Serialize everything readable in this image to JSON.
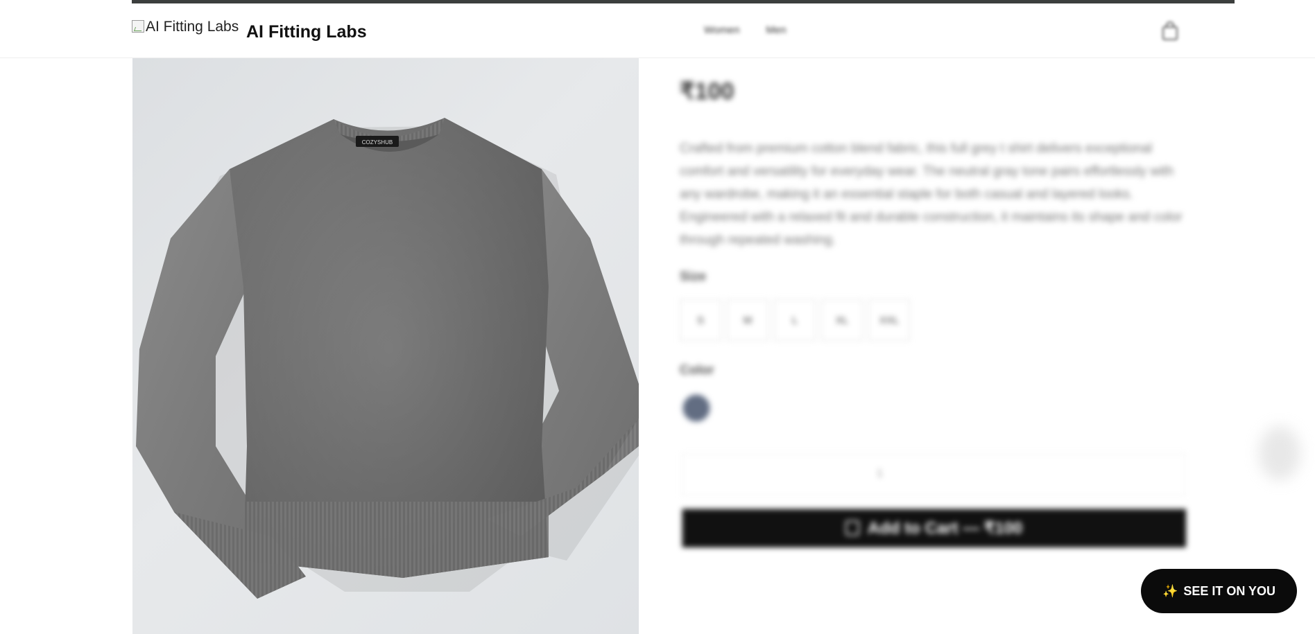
{
  "header": {
    "logo_alt": "AI Fitting Labs",
    "brand": "AI Fitting Labs",
    "nav": [
      "Women",
      "Men"
    ],
    "cart_icon": "shopping-bag-icon"
  },
  "product": {
    "image_alt": "Gray knit sweater",
    "label_tag": "COZYSHUB",
    "price": "₹100",
    "description": "Crafted from premium cotton blend fabric, this full grey t shirt delivers exceptional comfort and versatility for everyday wear. The neutral gray tone pairs effortlessly with any wardrobe, making it an essential staple for both casual and layered looks. Engineered with a relaxed fit and durable construction, it maintains its shape and color through repeated washing.",
    "size_label": "Size",
    "sizes": [
      "S",
      "M",
      "L",
      "XL",
      "XXL"
    ],
    "color_label": "Color",
    "colors": [
      "#626d82"
    ],
    "quantity": "1",
    "add_to_cart": "Add to Cart — ₹100"
  },
  "cta": {
    "icon": "sparkle-icon",
    "label": "SEE IT ON YOU"
  },
  "colors": {
    "primary": "#111111",
    "accent": "#f6b52a"
  }
}
